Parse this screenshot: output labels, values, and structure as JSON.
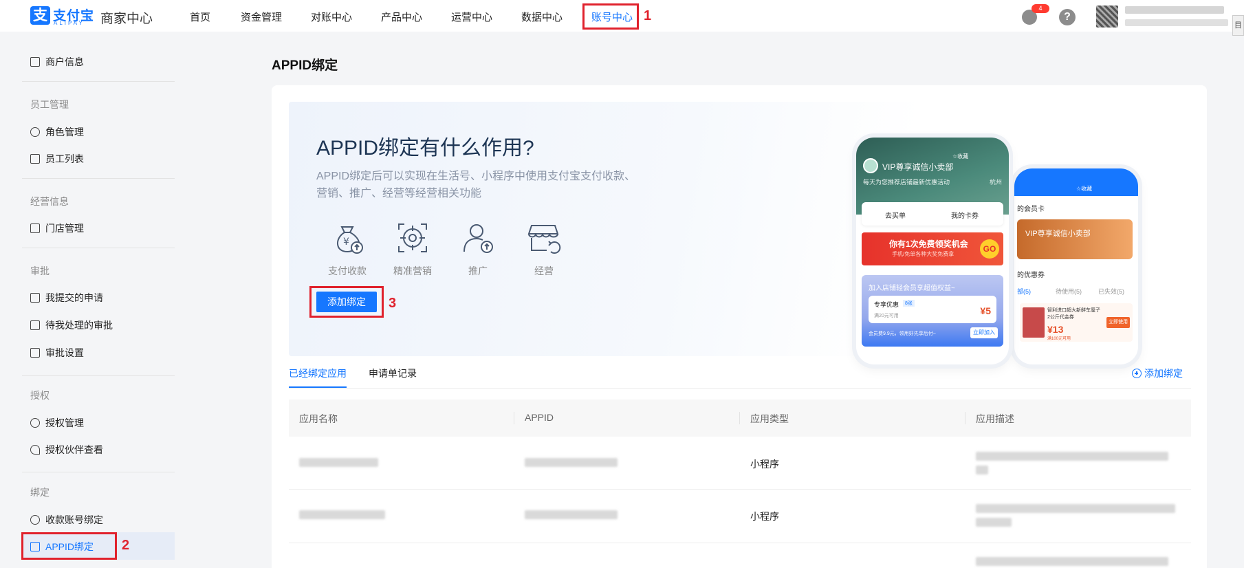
{
  "header": {
    "logo_cn": "支付宝",
    "logo_en": "ALIPAY",
    "console_title": "商家中心",
    "nav": [
      {
        "label": "首页"
      },
      {
        "label": "资金管理"
      },
      {
        "label": "对账中心"
      },
      {
        "label": "产品中心"
      },
      {
        "label": "运营中心"
      },
      {
        "label": "数据中心"
      },
      {
        "label": "账号中心",
        "active": true
      }
    ],
    "notification_count": "4",
    "help_glyph": "?",
    "edge_glyph": "目"
  },
  "annotations": [
    "1",
    "2",
    "3"
  ],
  "sidebar": {
    "merchant_info": "商户信息",
    "groups": [
      {
        "title": "员工管理",
        "items": [
          "角色管理",
          "员工列表"
        ]
      },
      {
        "title": "经营信息",
        "items": [
          "门店管理"
        ]
      },
      {
        "title": "审批",
        "items": [
          "我提交的申请",
          "待我处理的审批",
          "审批设置"
        ]
      },
      {
        "title": "授权",
        "items": [
          "授权管理",
          "授权伙伴查看"
        ]
      },
      {
        "title": "绑定",
        "items": [
          "收款账号绑定",
          "APPID绑定"
        ]
      }
    ],
    "active_item": "APPID绑定"
  },
  "page": {
    "title": "APPID绑定",
    "hero": {
      "title": "APPID绑定有什么作用?",
      "description": "APPID绑定后可以实现在生活号、小程序中使用支付宝支付收款、营销、推广、经营等经营相关功能",
      "features": [
        {
          "label": "支付收款",
          "icon": "money-bag-icon"
        },
        {
          "label": "精准营销",
          "icon": "target-icon"
        },
        {
          "label": "推广",
          "icon": "user-promote-icon"
        },
        {
          "label": "经营",
          "icon": "store-icon"
        }
      ],
      "add_button": "添加绑定"
    },
    "mock_phone_1": {
      "collect": "☆收藏",
      "store_name": "VIP尊享诚信小卖部",
      "subtitle": "每天为您推荐店铺最新优惠活动",
      "city": "杭州",
      "tab_buy": "去买单",
      "tab_cards": "我的卡券",
      "banner_title": "你有1次免费领奖机会",
      "banner_sub": "手机/免单各种大奖免费拿",
      "banner_go": "GO",
      "member_title": "加入店铺轻会员享超值权益~",
      "coupon_title": "专享优惠",
      "coupon_tag": "8张",
      "coupon_cond": "满20元可用",
      "coupon_value": "¥5",
      "member_foot": "会员费9.9元，领用好先享后付~",
      "join_button": "立即加入"
    },
    "mock_phone_2": {
      "collect": "☆收藏",
      "member_card": "的会员卡",
      "vip_name": "VIP尊享诚信小卖部",
      "coupons": "的优惠券",
      "coupon_tabs": [
        "部(5)",
        "待使用(5)",
        "已失效(5)"
      ],
      "item_title": "智利进口超大新鲜车厘子2公斤代金券",
      "item_value": "¥13",
      "item_cond": "满100元可用",
      "use_button": "立即使用"
    },
    "tabs": [
      {
        "label": "已经绑定应用",
        "active": true
      },
      {
        "label": "申请单记录"
      }
    ],
    "add_link": "添加绑定",
    "table": {
      "columns": [
        "应用名称",
        "APPID",
        "应用类型",
        "应用描述"
      ],
      "rows": [
        {
          "type": "小程序"
        },
        {
          "type": "小程序"
        }
      ]
    }
  }
}
